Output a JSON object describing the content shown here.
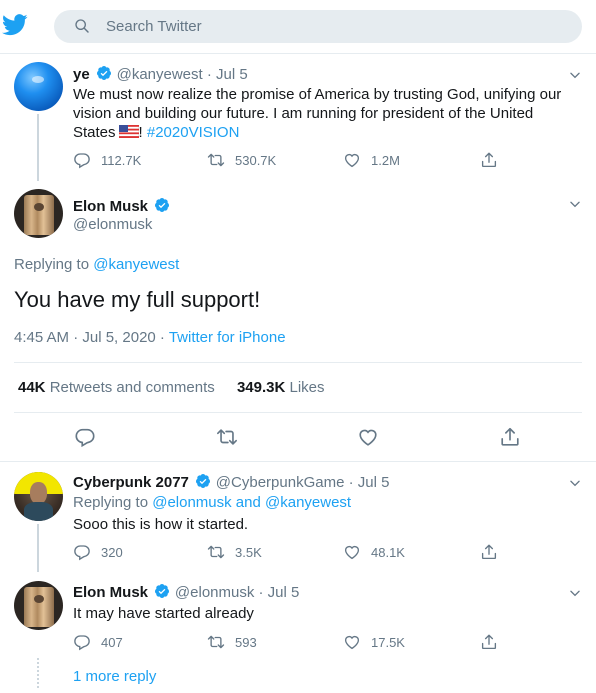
{
  "search": {
    "placeholder": "Search Twitter"
  },
  "tweets": {
    "ye": {
      "name": "ye",
      "handle_date": "@kanyewest · Jul 5",
      "text_line1": "We must now realize the promise of America by trusting God, unifying our",
      "text_line2": "vision and building our future. I am running for president of the United",
      "text_line3_pre": "States",
      "text_line3_mid": "! ",
      "hashtag": "#2020VISION",
      "replies": "112.7K",
      "retweets": "530.7K",
      "likes": "1.2M"
    },
    "main": {
      "name": "Elon Musk",
      "handle": "@elonmusk",
      "replying_label": "Replying to ",
      "replying_to": "@kanyewest",
      "text": "You have my full support!",
      "time": "4:45 AM · Jul 5, 2020 · ",
      "source": "Twitter for iPhone",
      "retweets_count": "44K",
      "retweets_label": "Retweets and comments",
      "likes_count": "349.3K",
      "likes_label": "Likes"
    },
    "cyberpunk": {
      "name": "Cyberpunk 2077",
      "handle_date": "@CyberpunkGame · Jul 5",
      "replying_label": "Replying to ",
      "replying_to": "@elonmusk and @kanyewest",
      "text": "Sooo this is how it started.",
      "replies": "320",
      "retweets": "3.5K",
      "likes": "48.1K"
    },
    "elon2": {
      "name": "Elon Musk",
      "handle_date": "@elonmusk · Jul 5",
      "text": "It may have started already",
      "replies": "407",
      "retweets": "593",
      "likes": "17.5K"
    }
  },
  "more_replies": "1 more reply",
  "colors": {
    "accent": "#1da1f2",
    "muted": "#657786",
    "border": "#e6ecf0",
    "verified": "#1da1f2"
  },
  "icons": [
    "twitter-logo-icon",
    "search-icon",
    "verified-icon",
    "chevron-down-icon",
    "reply-icon",
    "retweet-icon",
    "like-icon",
    "share-icon"
  ]
}
